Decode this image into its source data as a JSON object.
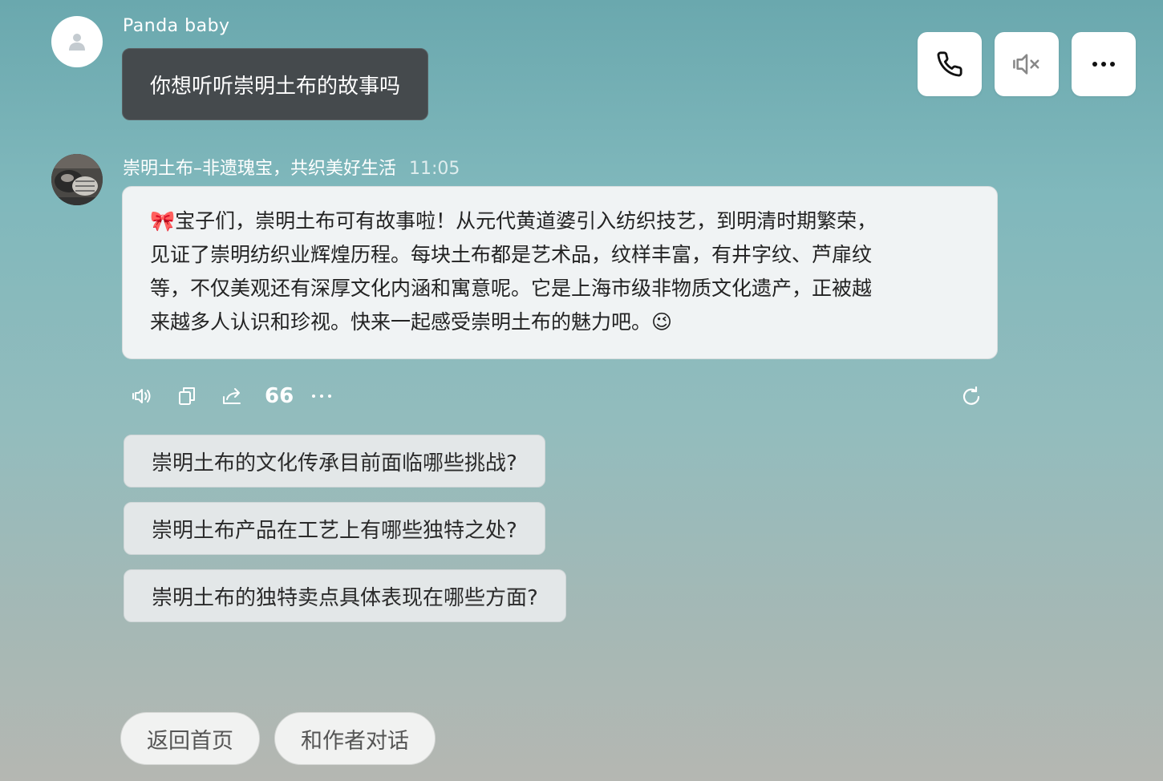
{
  "user": {
    "name": "Panda baby",
    "message": "你想听听崇明土布的故事吗"
  },
  "bot": {
    "name": "崇明土布–非遗瑰宝，共织美好生活",
    "time": "11:05",
    "message_lines": [
      "🎀宝子们，崇明土布可有故事啦！从元代黄道婆引入纺织技艺，到明清时期繁荣，",
      "见证了崇明纺织业辉煌历程。每块土布都是艺术品，纹样丰富，有井字纹、芦扉纹",
      "等，不仅美观还有深厚文化内涵和寓意呢。它是上海市级非物质文化遗产，正被越",
      "来越多人认识和珍视。快来一起感受崇明土布的魅力吧。😉"
    ]
  },
  "actions": {
    "icons": [
      "speaker-icon",
      "copy-icon",
      "share-icon",
      "quote-icon",
      "more-icon",
      "refresh-icon"
    ],
    "quote_label": "66",
    "more_label": "···"
  },
  "suggestions": [
    "崇明土布的文化传承目前面临哪些挑战?",
    "崇明土布产品在工艺上有哪些独特之处?",
    "崇明土布的独特卖点具体表现在哪些方面?"
  ],
  "bottom_buttons": {
    "home": "返回首页",
    "chat_author": "和作者对话"
  },
  "top_controls": [
    "phone-icon",
    "mute-icon",
    "more-options-icon"
  ],
  "colors": {
    "background_top": "#6aa8ae",
    "background_bottom": "#b5b7b2",
    "user_bubble": "#454a4d",
    "bot_bubble": "#f0f3f4",
    "suggestion_bg": "#e3e7e8"
  }
}
